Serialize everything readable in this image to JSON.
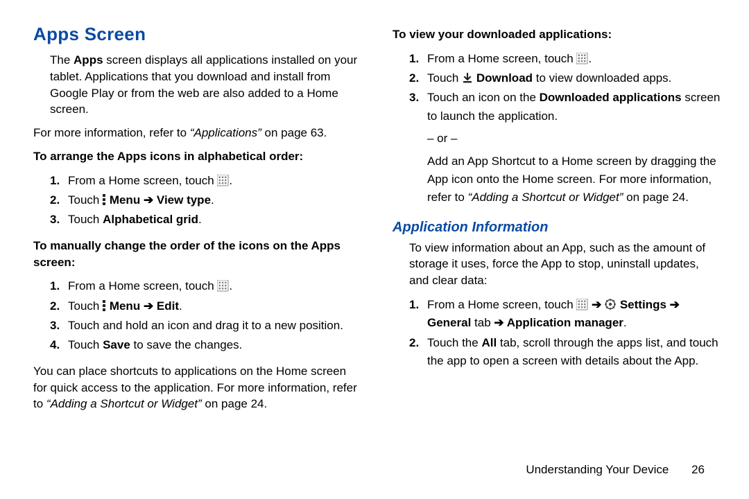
{
  "left": {
    "h1": "Apps Screen",
    "intro_prefix": "The ",
    "intro_bold": "Apps",
    "intro_rest": " screen displays all applications installed on your tablet. Applications that you download and install from Google Play or from the web are also added to a Home screen.",
    "more1_a": "For more information, refer to ",
    "more1_i": "“Applications”",
    "more1_b": " on page 63.",
    "task_a_head": "To arrange the Apps icons in alphabetical order:",
    "task_a_steps": {
      "s1a": "From a Home screen, touch ",
      "s1b": ".",
      "s2a": "Touch ",
      "s2b": " Menu ",
      "s2arrow": "➔",
      "s2c": " View type",
      "s2d": ".",
      "s3a": "Touch ",
      "s3b": "Alphabetical grid",
      "s3c": "."
    },
    "task_b_head": "To manually change the order of the icons on the Apps screen:",
    "task_b_steps": {
      "s1a": "From a Home screen, touch ",
      "s1b": ".",
      "s2a": "Touch ",
      "s2b": " Menu ",
      "s2arrow": "➔",
      "s2c": " Edit",
      "s2d": ".",
      "s3": "Touch and hold an icon and drag it to a new position.",
      "s4a": "Touch ",
      "s4b": "Save",
      "s4c": " to save the changes."
    },
    "tail_a": "You can place shortcuts to applications on the Home screen for quick access to the application. For more information, refer to ",
    "tail_i": "“Adding a Shortcut or Widget”",
    "tail_b": " on page 24."
  },
  "right": {
    "task_c_head": "To view your downloaded applications:",
    "task_c_steps": {
      "s1a": "From a Home screen, touch ",
      "s1b": ".",
      "s2a": "Touch ",
      "s2b": " Download",
      "s2c": " to view downloaded apps.",
      "s3a": "Touch an icon on the ",
      "s3b": "Downloaded applications",
      "s3c": " screen to launch the application.",
      "or": "– or –",
      "alt_a": "Add an App Shortcut to a Home screen by dragging the App icon onto the Home screen. For more information, refer to ",
      "alt_i": "“Adding a Shortcut or Widget”",
      "alt_b": " on page 24."
    },
    "h2": "Application Information",
    "intro": "To view information about an App, such as the amount of storage it uses, force the App to stop, uninstall updates, and clear data:",
    "task_d_steps": {
      "s1a": "From a Home screen, touch ",
      "s1arrow1": " ➔ ",
      "s1b": " Settings ",
      "s1arrow2": "➔",
      "s1c": " General",
      "s1d": " tab ",
      "s1arrow3": "➔",
      "s1e": " Application manager",
      "s1f": ".",
      "s2a": "Touch the ",
      "s2b": "All",
      "s2c": " tab, scroll through the apps list, and touch the app to open a screen with details about the App."
    }
  },
  "footer": {
    "chapter": "Understanding Your Device",
    "page": "26"
  }
}
